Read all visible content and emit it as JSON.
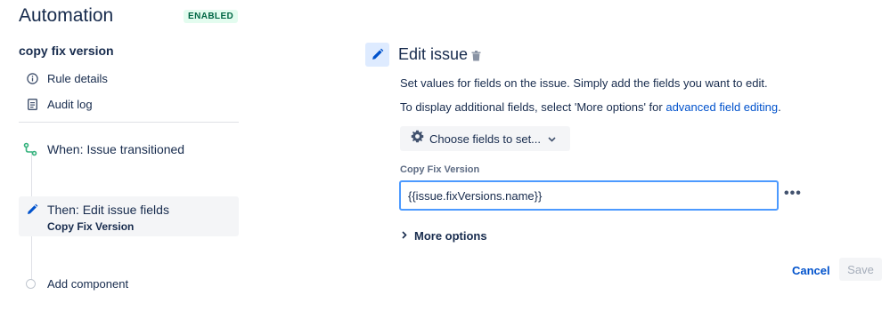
{
  "header": {
    "title": "Automation",
    "status_badge": "ENABLED"
  },
  "sidebar": {
    "rule_name": "copy fix version",
    "menu": [
      {
        "label": "Rule details",
        "icon": "info-icon"
      },
      {
        "label": "Audit log",
        "icon": "document-icon"
      }
    ],
    "steps": [
      {
        "label": "When: Issue transitioned",
        "icon": "transition-icon"
      },
      {
        "label": "Then: Edit issue fields",
        "sublabel": "Copy Fix Version",
        "icon": "pencil-icon"
      }
    ],
    "add_component_label": "Add component"
  },
  "panel": {
    "title": "Edit issue",
    "description_1": "Set values for fields on the issue. Simply add the fields you want to edit.",
    "description_2_prefix": "To display additional fields, select 'More options' for ",
    "description_2_link": "advanced field editing",
    "description_2_suffix": ".",
    "choose_fields_label": "Choose fields to set...",
    "field": {
      "label": "Copy Fix Version",
      "value": "{{issue.fixVersions.name}}"
    },
    "more_options_label": "More options",
    "cancel_label": "Cancel",
    "save_label": "Save"
  },
  "colors": {
    "accent": "#0052cc",
    "badge_bg": "#e3fcef",
    "badge_text": "#006644",
    "trigger_green": "#36b37e",
    "focus_border": "#4c9aff"
  }
}
